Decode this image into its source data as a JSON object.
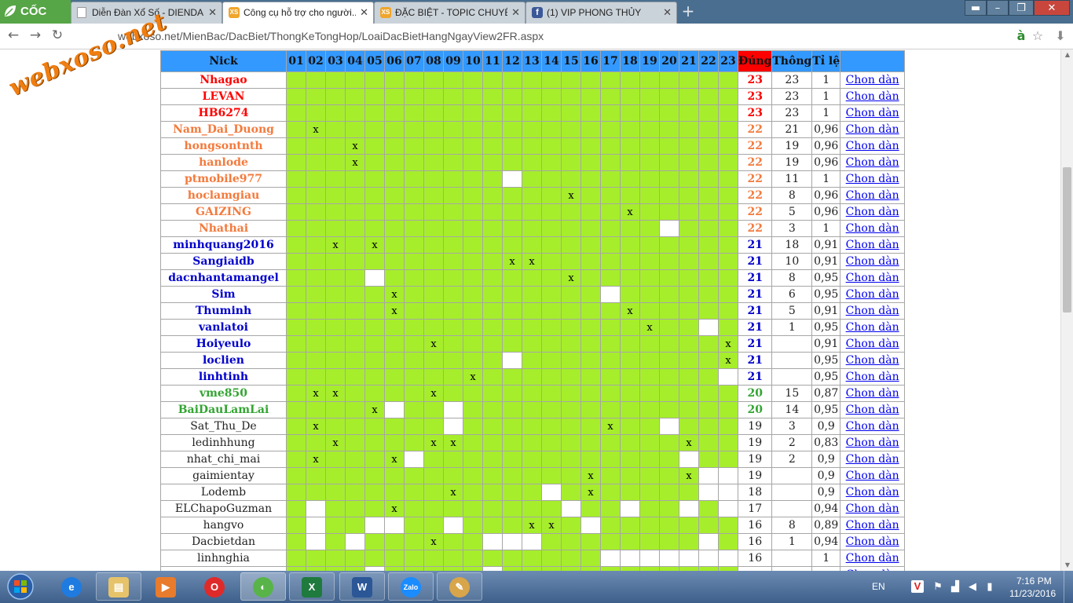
{
  "browser": {
    "brand": "CỐC CỐC",
    "tabs": [
      {
        "title": "Diễn Đàn Xổ Số - DIENDAN...",
        "favicon": "page-icon",
        "active": false
      },
      {
        "title": "Công cụ hỗ trợ cho người...",
        "favicon": "xs-icon",
        "active": true
      },
      {
        "title": "ĐẶC BIỆT - TOPIC CHUYÊN...",
        "favicon": "xs-icon",
        "active": false
      },
      {
        "title": "(1) VIP PHONG THỦY",
        "favicon": "facebook-icon",
        "active": false
      }
    ],
    "url": "webxoso.net/MienBac/DacBiet/ThongKeTongHop/LoaiDacBietHangNgayView2FR.aspx",
    "watermark": "webxoso.net"
  },
  "table": {
    "headers": {
      "nick": "Nick",
      "dung": "Đúng",
      "thong": "Thông",
      "tile": "Tỉ lệ",
      "action": ""
    },
    "days": [
      "01",
      "02",
      "03",
      "04",
      "05",
      "06",
      "07",
      "08",
      "09",
      "10",
      "11",
      "12",
      "13",
      "14",
      "15",
      "16",
      "17",
      "18",
      "19",
      "20",
      "21",
      "22",
      "23"
    ],
    "link_label": "Chon dàn",
    "rows": [
      {
        "nick": "Nhagao",
        "tier": "red",
        "dung": "23",
        "thong": "23",
        "tile": "1",
        "cells": ""
      },
      {
        "nick": "LEVAN",
        "tier": "red",
        "dung": "23",
        "thong": "23",
        "tile": "1",
        "cells": ""
      },
      {
        "nick": "HB6274",
        "tier": "red",
        "dung": "23",
        "thong": "23",
        "tile": "1",
        "cells": ""
      },
      {
        "nick": "Nam_Dai_Duong",
        "tier": "orange",
        "dung": "22",
        "thong": "21",
        "tile": "0,96",
        "cells": "02:x"
      },
      {
        "nick": "hongsontnth",
        "tier": "orange",
        "dung": "22",
        "thong": "19",
        "tile": "0,96",
        "cells": "04:x"
      },
      {
        "nick": "hanlode",
        "tier": "orange",
        "dung": "22",
        "thong": "19",
        "tile": "0,96",
        "cells": "04:x"
      },
      {
        "nick": "ptmobile977",
        "tier": "orange",
        "dung": "22",
        "thong": "11",
        "tile": "1",
        "cells": "12:b"
      },
      {
        "nick": "hoclamgiau",
        "tier": "orange",
        "dung": "22",
        "thong": "8",
        "tile": "0,96",
        "cells": "15:x"
      },
      {
        "nick": "GAIZING",
        "tier": "orange",
        "dung": "22",
        "thong": "5",
        "tile": "0,96",
        "cells": "18:x"
      },
      {
        "nick": "Nhathai",
        "tier": "orange",
        "dung": "22",
        "thong": "3",
        "tile": "1",
        "cells": "20:b"
      },
      {
        "nick": "minhquang2016",
        "tier": "blue",
        "dung": "21",
        "thong": "18",
        "tile": "0,91",
        "cells": "03:x,05:x"
      },
      {
        "nick": "Sangiaidb",
        "tier": "blue",
        "dung": "21",
        "thong": "10",
        "tile": "0,91",
        "cells": "12:x,13:x"
      },
      {
        "nick": "dacnhantamangel",
        "tier": "blue",
        "dung": "21",
        "thong": "8",
        "tile": "0,95",
        "cells": "05:b,15:x"
      },
      {
        "nick": "Sim",
        "tier": "blue",
        "dung": "21",
        "thong": "6",
        "tile": "0,95",
        "cells": "06:x,17:b"
      },
      {
        "nick": "Thuminh",
        "tier": "blue",
        "dung": "21",
        "thong": "5",
        "tile": "0,91",
        "cells": "06:x,18:x"
      },
      {
        "nick": "vanlatoi",
        "tier": "blue",
        "dung": "21",
        "thong": "1",
        "tile": "0,95",
        "cells": "19:x,22:b"
      },
      {
        "nick": "Hoiyeulo",
        "tier": "blue",
        "dung": "21",
        "thong": "",
        "tile": "0,91",
        "cells": "08:x,23:x"
      },
      {
        "nick": "loclien",
        "tier": "blue",
        "dung": "21",
        "thong": "",
        "tile": "0,95",
        "cells": "12:b,23:x"
      },
      {
        "nick": "linhtinh",
        "tier": "blue",
        "dung": "21",
        "thong": "",
        "tile": "0,95",
        "cells": "10:x,23:b"
      },
      {
        "nick": "vme850",
        "tier": "green",
        "dung": "20",
        "thong": "15",
        "tile": "0,87",
        "cells": "02:x,03:x,08:x"
      },
      {
        "nick": "BaiDauLamLai",
        "tier": "green",
        "dung": "20",
        "thong": "14",
        "tile": "0,95",
        "cells": "05:x,06:b,09:b"
      },
      {
        "nick": "Sat_Thu_De",
        "tier": "black",
        "dung": "19",
        "thong": "3",
        "tile": "0,9",
        "cells": "02:x,09:b,17:x,20:b"
      },
      {
        "nick": "ledinhhung",
        "tier": "black",
        "dung": "19",
        "thong": "2",
        "tile": "0,83",
        "cells": "03:x,08:x,09:x,21:x"
      },
      {
        "nick": "nhat_chi_mai",
        "tier": "black",
        "dung": "19",
        "thong": "2",
        "tile": "0,9",
        "cells": "02:x,06:x,07:b,21:b"
      },
      {
        "nick": "gaimientay",
        "tier": "black",
        "dung": "19",
        "thong": "",
        "tile": "0,9",
        "cells": "16:x,21:x,22:b,23:b"
      },
      {
        "nick": "Lodemb",
        "tier": "black",
        "dung": "18",
        "thong": "",
        "tile": "0,9",
        "cells": "09:x,14:b,16:x,22:b,23:b"
      },
      {
        "nick": "ELChapoGuzman",
        "tier": "black",
        "dung": "17",
        "thong": "",
        "tile": "0,94",
        "cells": "02:b,06:x,15:b,18:b,21:b,23:b"
      },
      {
        "nick": "hangvo",
        "tier": "black",
        "dung": "16",
        "thong": "8",
        "tile": "0,89",
        "cells": "02:b,05:b,06:b,09:b,13:x,14:x,16:b"
      },
      {
        "nick": "Dacbietdan",
        "tier": "black",
        "dung": "16",
        "thong": "1",
        "tile": "0,94",
        "cells": "02:b,04:b,08:x,11:b,12:b,13:b,22:b"
      },
      {
        "nick": "linhnghia",
        "tier": "black",
        "dung": "16",
        "thong": "",
        "tile": "1",
        "cells": "17:b,18:b,19:b,20:b,21:b,22:b,23:b"
      },
      {
        "nick": "",
        "tier": "black",
        "dung": "",
        "thong": "",
        "tile": "",
        "cells": "05:b,11:b"
      }
    ]
  },
  "taskbar": {
    "apps": [
      "ie-icon",
      "explorer-icon",
      "media-icon",
      "opera-icon",
      "coccoc-icon",
      "excel-icon",
      "word-icon",
      "zalo-icon",
      "paint-icon"
    ],
    "zalo_label": "Zalo",
    "lang": "EN",
    "time": "7:16 PM",
    "date": "11/23/2016"
  }
}
